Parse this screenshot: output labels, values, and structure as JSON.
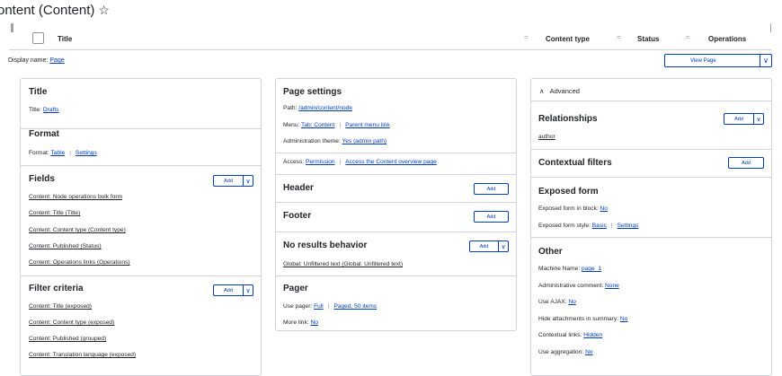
{
  "page": {
    "title": "ontent (Content)",
    "star": "☆"
  },
  "preview_table": {
    "col_title": "Title",
    "col_content_type": "Content type",
    "col_status": "Status",
    "col_operations": "Operations",
    "sort_glyph": "="
  },
  "display_name": {
    "label": "Display name:",
    "value": "Page"
  },
  "view_button": {
    "label": "View Page",
    "caret": "∨"
  },
  "left": {
    "title": {
      "heading": "Title",
      "label": "Title:",
      "value": "Drafts"
    },
    "format": {
      "heading": "Format",
      "label": "Format:",
      "value": "Table",
      "settings": "Settings"
    },
    "fields": {
      "heading": "Fields",
      "add": "Add",
      "items": [
        "Content: Node operations bulk form",
        "Content: Title (Title)",
        "Content: Content type (Content type)",
        "Content: Published (Status)",
        "Content: Operations links (Operations)"
      ]
    },
    "filter": {
      "heading": "Filter criteria",
      "add": "Add",
      "items": [
        "Content: Title (exposed)",
        "Content: Content type (exposed)",
        "Content: Published (grouped)",
        "Content: Translation language (exposed)"
      ]
    }
  },
  "middle": {
    "page_settings": {
      "heading": "Page settings",
      "path_label": "Path:",
      "path_value": "/admin/content/node",
      "menu_label": "Menu:",
      "menu_value": "Tab: Content",
      "menu_parent": "Parent menu link",
      "theme_label": "Administration theme:",
      "theme_value": "Yes (admin path)",
      "access_label": "Access:",
      "access_value": "Permission",
      "access_link": "Access the Content overview page"
    },
    "header": {
      "heading": "Header",
      "add": "Add"
    },
    "footer": {
      "heading": "Footer",
      "add": "Add"
    },
    "no_results": {
      "heading": "No results behavior",
      "add": "Add",
      "item": "Global: Unfiltered text (Global: Unfiltered text)"
    },
    "pager": {
      "heading": "Pager",
      "use_label": "Use pager:",
      "use_value": "Full",
      "use_detail": "Paged, 50 items",
      "more_label": "More link:",
      "more_value": "No"
    }
  },
  "right": {
    "advanced": {
      "label": "Advanced",
      "chevron": "∧"
    },
    "relationships": {
      "heading": "Relationships",
      "add": "Add",
      "item": "author"
    },
    "contextual": {
      "heading": "Contextual filters",
      "add": "Add"
    },
    "exposed": {
      "heading": "Exposed form",
      "block_label": "Exposed form in block:",
      "block_value": "No",
      "style_label": "Exposed form style:",
      "style_value": "Basic",
      "style_settings": "Settings"
    },
    "other": {
      "heading": "Other",
      "rows": [
        {
          "label": "Machine Name:",
          "value": "page_1"
        },
        {
          "label": "Administrative comment:",
          "value": "None"
        },
        {
          "label": "Use AJAX:",
          "value": "No"
        },
        {
          "label": "Hide attachments in summary:",
          "value": "No"
        },
        {
          "label": "Contextual links:",
          "value": "Hidden"
        },
        {
          "label": "Use aggregation:",
          "value": "No"
        }
      ]
    }
  },
  "colors": {
    "link": "#003cc5",
    "border": "#d3d4d9",
    "text": "#232429"
  }
}
